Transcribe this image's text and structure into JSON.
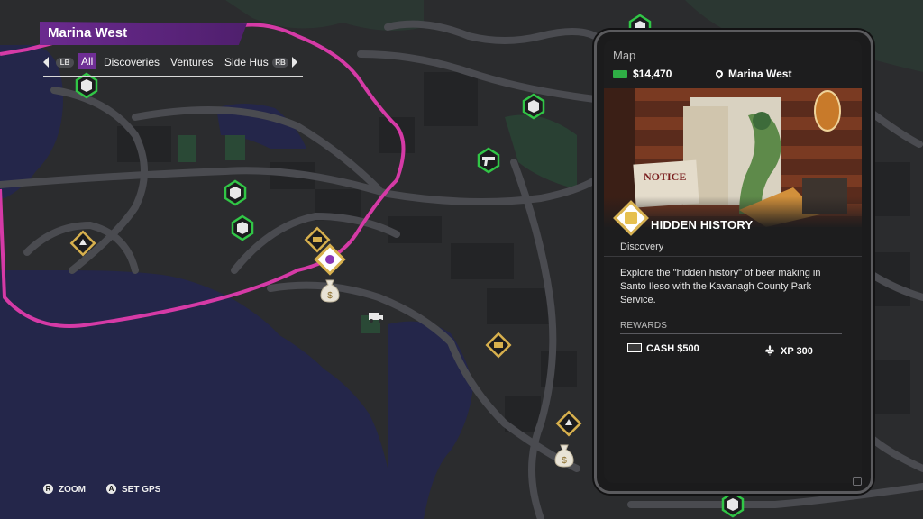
{
  "location": {
    "district": "Marina West"
  },
  "filter_bar": {
    "left_button": "LB",
    "right_button": "RB",
    "tabs": [
      "All",
      "Discoveries",
      "Ventures",
      "Side Hus"
    ]
  },
  "panel": {
    "title": "Map",
    "money": "$14,470",
    "location": "Marina West",
    "mission": {
      "title": "HIDDEN HISTORY",
      "type": "Discovery",
      "description": "Explore the \"hidden history\" of beer making in Santo Ileso with the Kavanagh County Park Service.",
      "image_sign": "NOTICE"
    },
    "rewards": {
      "label": "REWARDS",
      "cash": "CASH $500",
      "xp": "XP 300"
    }
  },
  "hints": {
    "zoom": {
      "button": "R",
      "label": "ZOOM"
    },
    "gps": {
      "button": "A",
      "label": "SET GPS"
    }
  },
  "colors": {
    "map_bg": "#2a2b2d",
    "water": "#232441",
    "roads": "#4c4d51",
    "district_border": "#d53aa6",
    "title_banner": "#6b2a8f",
    "activity_green": "#31c646",
    "discovery_gold": "#d7b04d",
    "cash_green": "#2fae45"
  },
  "map_icons": [
    "crowd-activity-icon",
    "crowd-activity-icon",
    "crowd-activity-icon",
    "crowd-activity-icon",
    "crowd-activity-icon",
    "crowd-activity-icon",
    "gun-store-icon",
    "discovery-icon",
    "discovery-icon",
    "discovery-icon",
    "discovery-icon",
    "selected-mission-icon",
    "cash-bag-icon",
    "cash-bag-icon",
    "delivery-truck-icon"
  ]
}
